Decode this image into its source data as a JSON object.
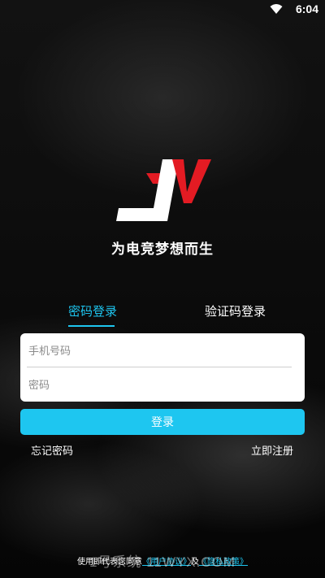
{
  "status": {
    "time": "6:04"
  },
  "brand": {
    "slogan": "为电竞梦想而生"
  },
  "tabs": [
    {
      "label": "密码登录",
      "active": true
    },
    {
      "label": "验证码登录",
      "active": false
    }
  ],
  "form": {
    "phone_placeholder": "手机号码",
    "phone_value": "",
    "password_placeholder": "密码",
    "password_value": ""
  },
  "actions": {
    "login": "登录",
    "forgot": "忘记密码",
    "register": "立即注册"
  },
  "agreement": {
    "prefix": "使用即代表您同意",
    "link1": "《用户协议》",
    "and": "及",
    "link2": "《隐私政策》"
  },
  "watermark": "1号系统 11WYX.COM",
  "colors": {
    "accent": "#1ec6f0",
    "logo_red": "#e31b23"
  }
}
